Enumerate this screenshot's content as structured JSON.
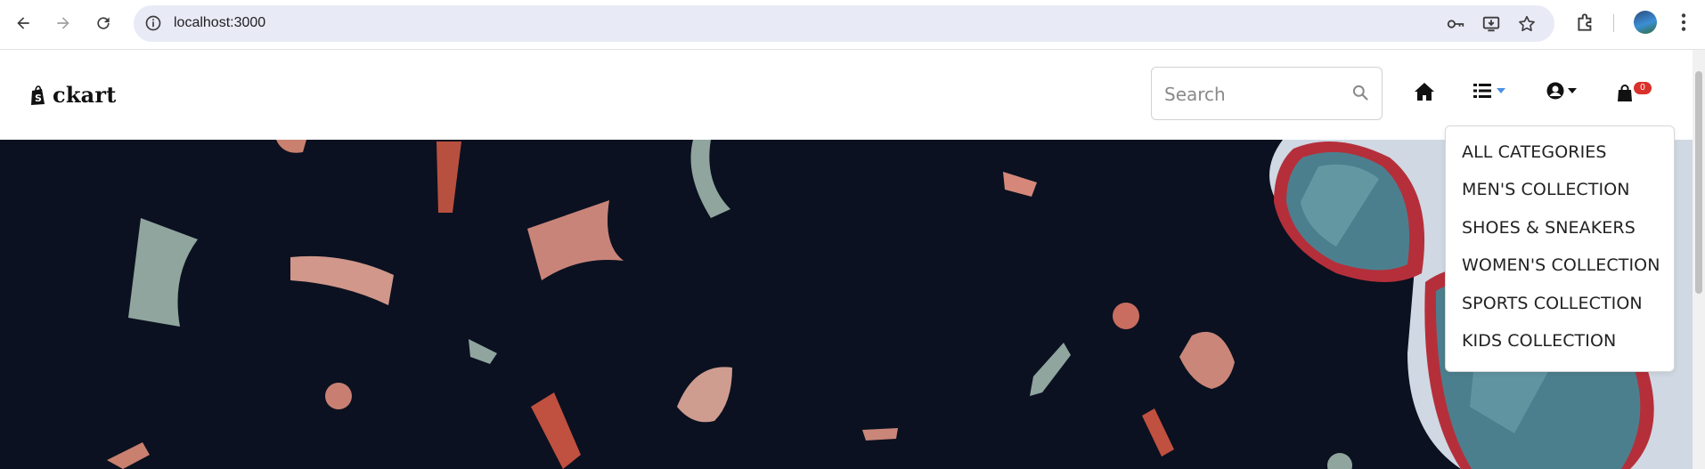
{
  "browser": {
    "url": "localhost:3000",
    "icons": [
      "back-icon",
      "forward-icon",
      "reload-icon",
      "site-info-icon",
      "password-key-icon",
      "install-app-icon",
      "bookmark-star-icon",
      "extensions-icon",
      "profile-avatar",
      "more-menu-icon"
    ]
  },
  "site": {
    "logo_text": "ckart",
    "search_placeholder": "Search",
    "cart_count": "0"
  },
  "dropdown": {
    "items": [
      "ALL CATEGORIES",
      "MEN'S COLLECTION",
      "SHOES & SNEAKERS",
      "WOMEN'S COLLECTION",
      "SPORTS COLLECTION",
      "KIDS COLLECTION"
    ]
  },
  "colors": {
    "hero_bg": "#0b1120",
    "accent_badge": "#d9312b",
    "caret_blue": "#4a90e2"
  }
}
